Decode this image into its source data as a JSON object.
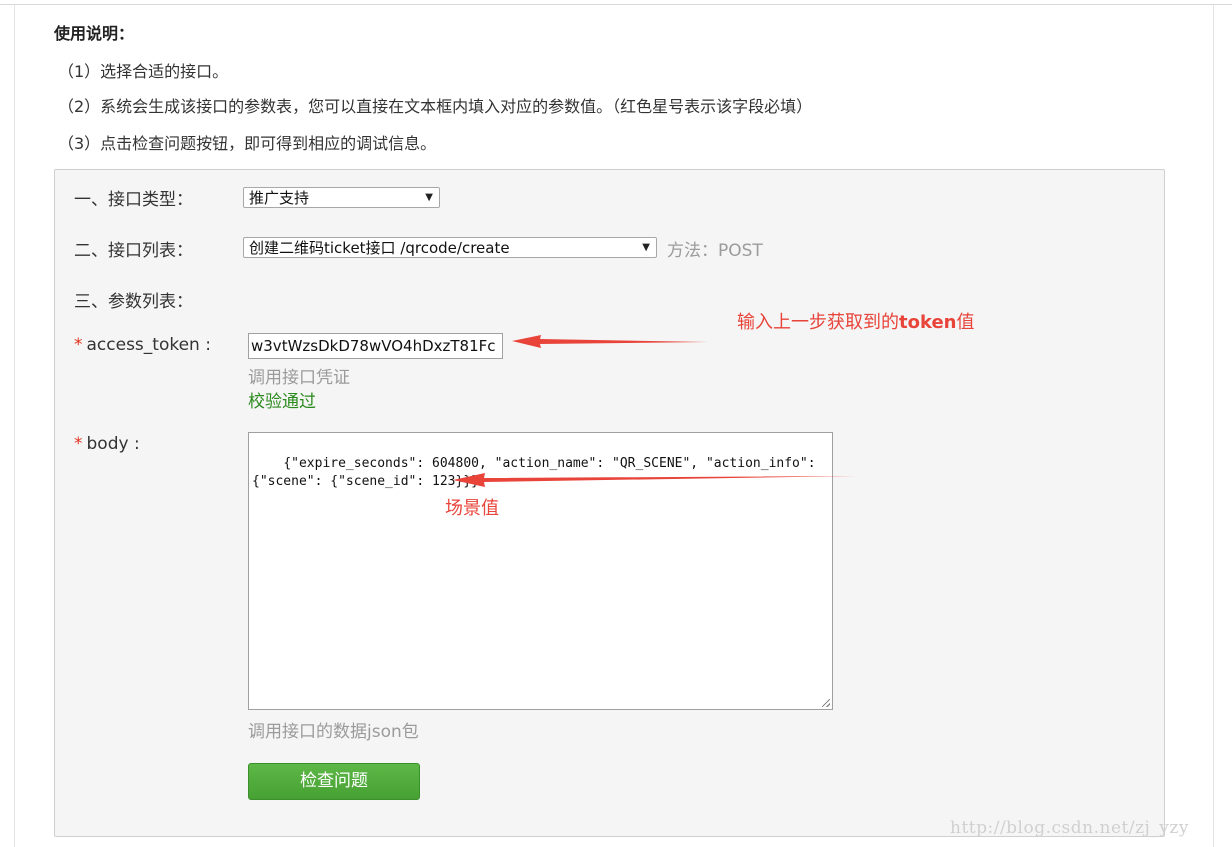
{
  "usage": {
    "title": "使用说明：",
    "steps": [
      "（1）选择合适的接口。",
      "（2）系统会生成该接口的参数表，您可以直接在文本框内填入对应的参数值。（红色星号表示该字段必填）",
      "（3）点击检查问题按钮，即可得到相应的调试信息。"
    ]
  },
  "form": {
    "interface_type": {
      "label": "一、接口类型：",
      "selected": "推广支持"
    },
    "interface_list": {
      "label": "二、接口列表：",
      "selected": "创建二维码ticket接口 /qrcode/create",
      "method": "方法：POST"
    },
    "params_label": "三、参数列表：",
    "access_token": {
      "star": "*",
      "label": "access_token :",
      "value": "w3vtWzsDkD78wVO4hDxzT81Fc",
      "hint": "调用接口凭证",
      "status": "校验通过"
    },
    "body": {
      "star": "*",
      "label": "body :",
      "value": "{\"expire_seconds\": 604800, \"action_name\": \"QR_SCENE\", \"action_info\": {\"scene\": {\"scene_id\": 123}}}",
      "hint": "调用接口的数据json包"
    },
    "check_button": "检查问题"
  },
  "annotations": {
    "token_note_prefix": "输入上一步获取到的",
    "token_note_bold": "token",
    "token_note_suffix": "值",
    "scene_note": "场景值"
  },
  "watermark": "http://blog.csdn.net/zj_yzy",
  "colors": {
    "required_star": "#e0301e",
    "valid_text": "#2b8a1e",
    "button_green": "#4caf3a",
    "annotation_red": "#e8443a"
  }
}
